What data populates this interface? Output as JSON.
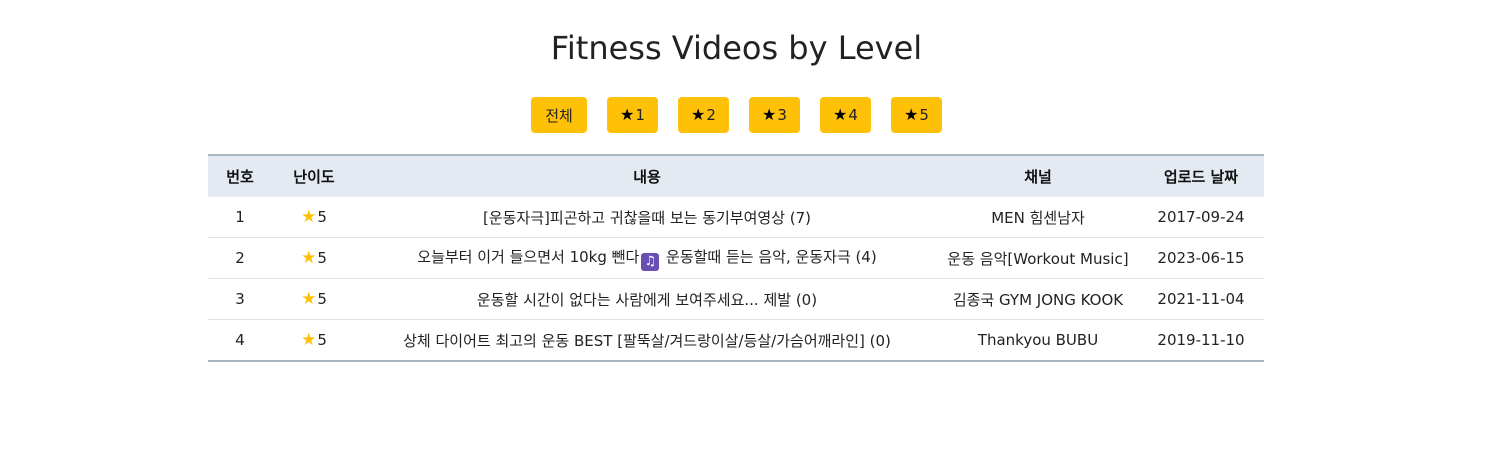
{
  "title": "Fitness Videos by Level",
  "filters": [
    {
      "label": "전체",
      "icon": null
    },
    {
      "label": "1",
      "icon": "star-icon"
    },
    {
      "label": "2",
      "icon": "star-icon"
    },
    {
      "label": "3",
      "icon": "star-icon"
    },
    {
      "label": "4",
      "icon": "star-icon"
    },
    {
      "label": "5",
      "icon": "star-icon"
    }
  ],
  "table": {
    "headers": [
      "번호",
      "난이도",
      "내용",
      "채널",
      "업로드 날짜"
    ],
    "rows": [
      {
        "num": "1",
        "level": "5",
        "content": "[운동자극]피곤하고 귀찮을때 보는 동기부여영상 (7)",
        "content_before": "",
        "content_after": "",
        "channel": "MEN 힘센남자",
        "date": "2017-09-24"
      },
      {
        "num": "2",
        "level": "5",
        "content": "",
        "content_before": "오늘부터 이거 들으면서 10kg 뺀다",
        "content_after": " 운동할때 듣는 음악, 운동자극 (4)",
        "channel": "운동 음악[Workout Music]",
        "date": "2023-06-15"
      },
      {
        "num": "3",
        "level": "5",
        "content": "운동할 시간이 없다는 사람에게 보여주세요... 제발 (0)",
        "content_before": "",
        "content_after": "",
        "channel": "김종국 GYM JONG KOOK",
        "date": "2021-11-04"
      },
      {
        "num": "4",
        "level": "5",
        "content": "상체 다이어트 최고의 운동 BEST [팔뚝살/겨드랑이살/등살/가슴어깨라인] (0)",
        "content_before": "",
        "content_after": "",
        "channel": "Thankyou BUBU",
        "date": "2019-11-10"
      }
    ]
  },
  "colors": {
    "accent": "#ffc107",
    "header_bg": "#e4eaf1",
    "border": "#a9b6c2"
  }
}
